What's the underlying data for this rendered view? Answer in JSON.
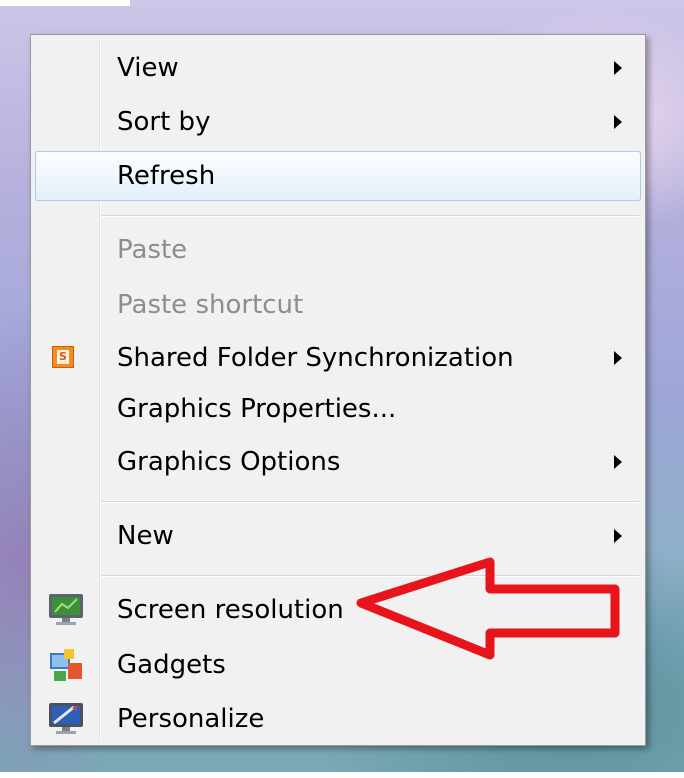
{
  "context_menu": {
    "items": [
      {
        "id": "view",
        "label": "View",
        "submenu": true,
        "disabled": false
      },
      {
        "id": "sort-by",
        "label": "Sort by",
        "submenu": true,
        "disabled": false
      },
      {
        "id": "refresh",
        "label": "Refresh",
        "submenu": false,
        "disabled": false,
        "highlighted": true
      },
      {
        "id": "paste",
        "label": "Paste",
        "submenu": false,
        "disabled": true
      },
      {
        "id": "paste-shortcut",
        "label": "Paste shortcut",
        "submenu": false,
        "disabled": true
      },
      {
        "id": "shared-folder-sync",
        "label": "Shared Folder Synchronization",
        "submenu": true,
        "disabled": false,
        "icon": "shared-folder-sync-icon"
      },
      {
        "id": "graphics-properties",
        "label": "Graphics Properties...",
        "submenu": false,
        "disabled": false
      },
      {
        "id": "graphics-options",
        "label": "Graphics Options",
        "submenu": true,
        "disabled": false
      },
      {
        "id": "new",
        "label": "New",
        "submenu": true,
        "disabled": false
      },
      {
        "id": "screen-resolution",
        "label": "Screen resolution",
        "submenu": false,
        "disabled": false,
        "icon": "monitor-icon"
      },
      {
        "id": "gadgets",
        "label": "Gadgets",
        "submenu": false,
        "disabled": false,
        "icon": "gadgets-icon"
      },
      {
        "id": "personalize",
        "label": "Personalize",
        "submenu": false,
        "disabled": false,
        "icon": "personalize-icon"
      }
    ]
  },
  "icon_text": {
    "shared_folder_sync": "S"
  },
  "annotation": {
    "type": "arrow",
    "color": "#e8141c",
    "points_to": "screen-resolution"
  },
  "colors": {
    "highlight_border": "#a9c9ef",
    "disabled_text": "#8d8d8d",
    "menu_bg": "#f1f1f1"
  }
}
